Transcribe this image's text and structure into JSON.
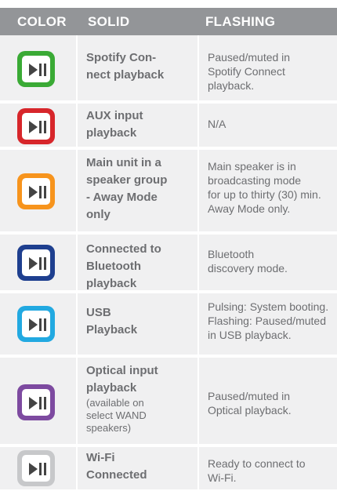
{
  "header": {
    "color": "COLOR",
    "solid": "SOLID",
    "flashing": "FLASHING"
  },
  "rows": [
    {
      "icon": "green-play-pause-icon",
      "color": "#3aaa35",
      "solid": "Spotify Con-\nnect playback",
      "flashing": "Paused/muted in\nSpotify Connect\nplayback."
    },
    {
      "icon": "red-play-pause-icon",
      "color": "#d7262b",
      "solid": "AUX input\nplayback",
      "flashing": "N/A"
    },
    {
      "icon": "orange-play-pause-icon",
      "color": "#f7941d",
      "solid": "Main unit in a\nspeaker group\n- Away Mode\nonly",
      "flashing": "Main speaker is in\nbroadcasting mode\nfor up to thirty (30) min.\nAway Mode only."
    },
    {
      "icon": "blue-play-pause-icon",
      "color": "#1e3f8f",
      "solid": "Connected to\nBluetooth\nplayback",
      "flashing": "Bluetooth\ndiscovery mode."
    },
    {
      "icon": "light-blue-play-pause-icon",
      "color": "#22a9e1",
      "solid": "USB\nPlayback",
      "flashing": "Pulsing: System booting.\nFlashing: Paused/muted\nin USB playback."
    },
    {
      "icon": "purple-play-pause-icon",
      "color": "#7d4aa0",
      "solid": "Optical input\nplayback",
      "solid_note": "(available on\nselect WAND\nspeakers)",
      "flashing": "Paused/muted in\nOptical playback."
    },
    {
      "icon": "gray-play-pause-icon",
      "color": "#c7c8ca",
      "solid": "Wi-Fi\nConnected",
      "flashing": "Ready to connect to\nWi-Fi."
    }
  ]
}
